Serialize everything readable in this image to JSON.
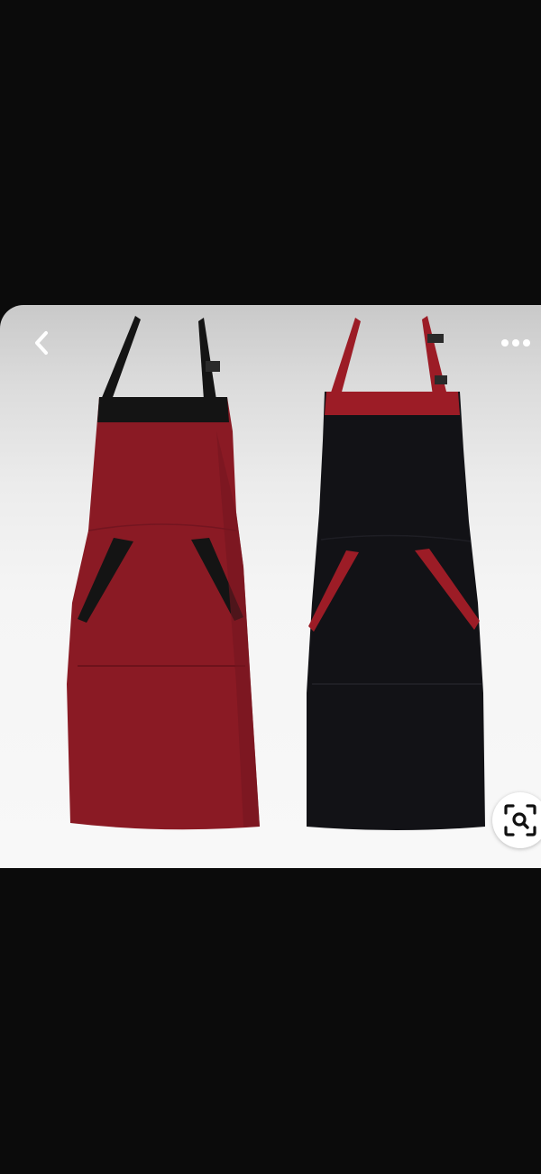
{
  "viewer": {
    "back_icon": "chevron-left-icon",
    "more_icon": "more-horizontal-icon",
    "visual_search_icon": "visual-search-icon"
  },
  "product": {
    "items": [
      {
        "name": "burgundy-apron",
        "body_color": "#8a1a24",
        "trim_color": "#111111"
      },
      {
        "name": "black-apron",
        "body_color": "#121216",
        "trim_color": "#9c1c26"
      }
    ]
  },
  "colors": {
    "background": "#0b0b0b",
    "icon_light": "#ffffff",
    "icon_dark": "#111111"
  }
}
